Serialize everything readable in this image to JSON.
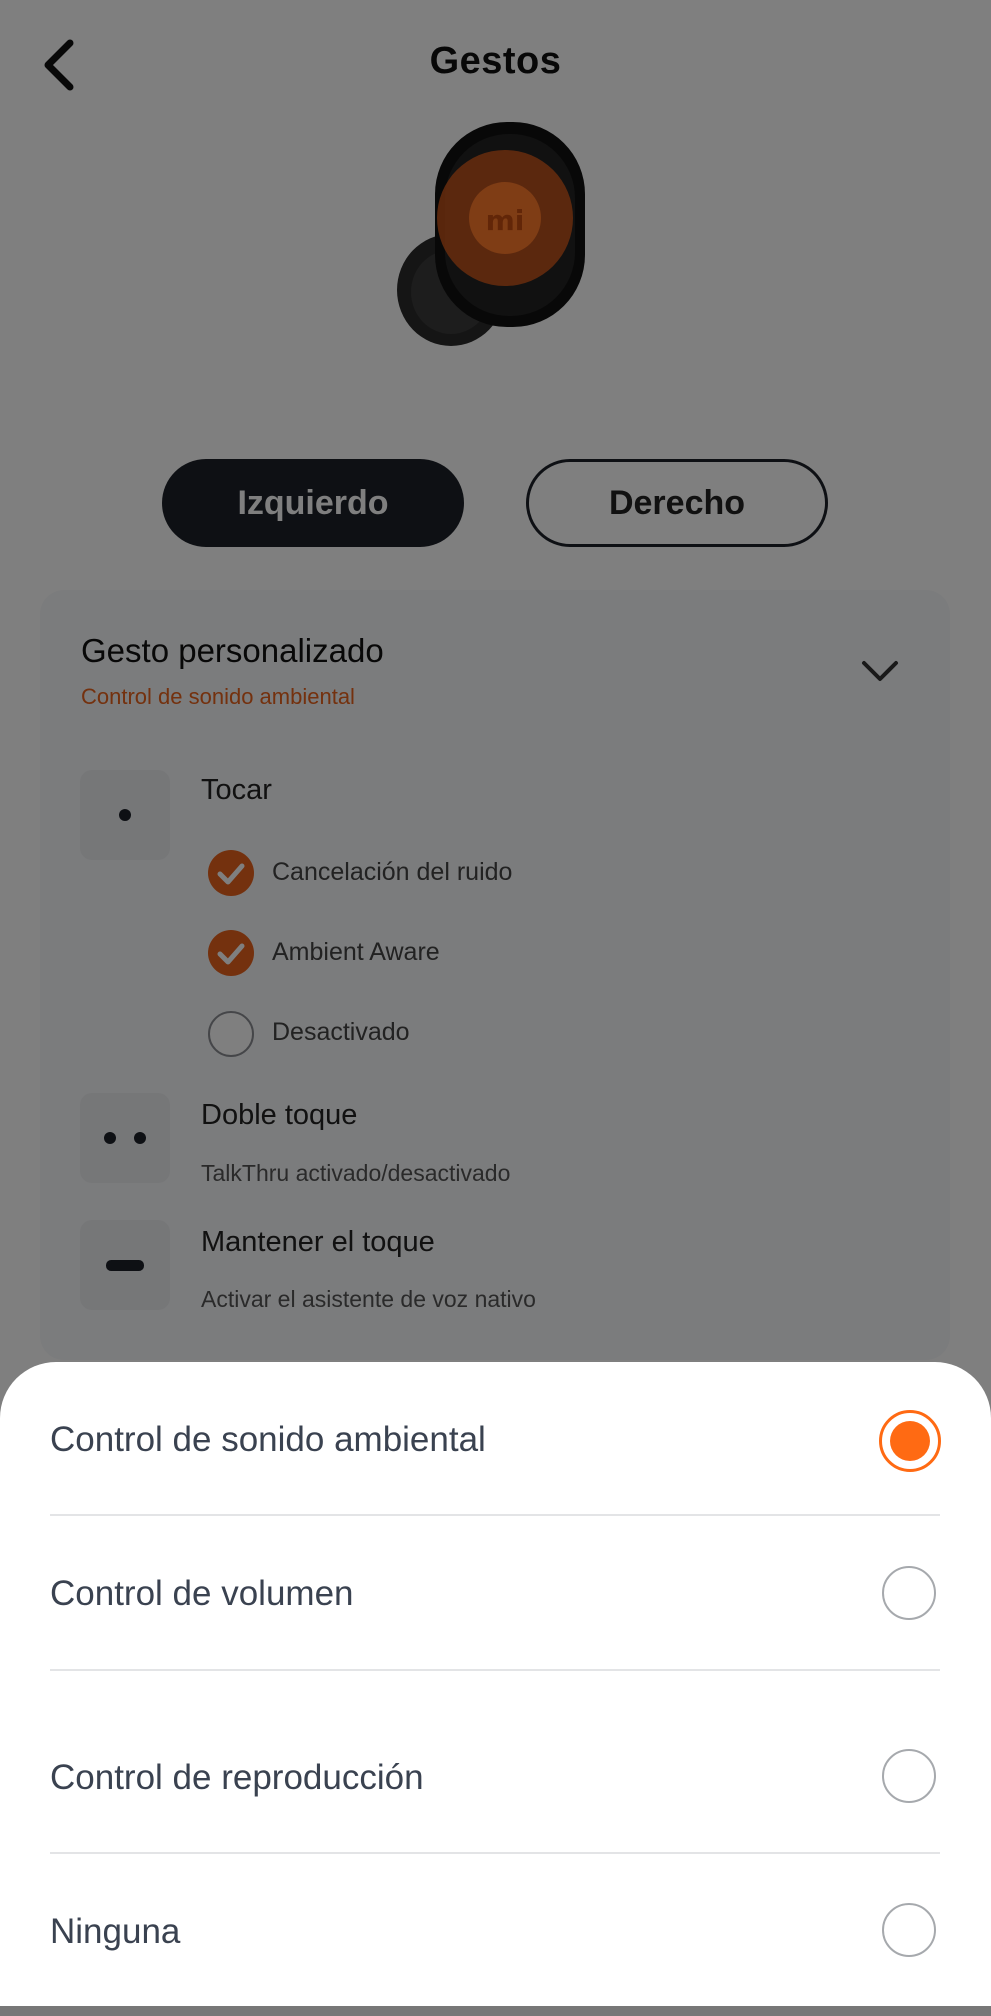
{
  "header": {
    "title": "Gestos",
    "back_icon": "chevron-left-icon"
  },
  "earbud": {
    "icon": "earbud-image",
    "highlight_color": "#e8621c"
  },
  "tabs": [
    {
      "label": "Izquierdo",
      "selected": true
    },
    {
      "label": "Derecho",
      "selected": false
    }
  ],
  "card": {
    "title": "Gesto personalizado",
    "subtitle": "Control de sonido ambiental",
    "expand_icon": "chevron-down-icon",
    "gestures": [
      {
        "label": "Tocar",
        "icon": "single-tap-icon",
        "options": [
          {
            "label": "Cancelación del ruido",
            "checked": true
          },
          {
            "label": "Ambient Aware",
            "checked": true
          },
          {
            "label": "Desactivado",
            "checked": false
          }
        ]
      },
      {
        "label": "Doble toque",
        "icon": "double-tap-icon",
        "description": "TalkThru activado/desactivado"
      },
      {
        "label": "Mantener el toque",
        "icon": "hold-icon",
        "description": "Activar el asistente de voz nativo"
      }
    ]
  },
  "sheet": {
    "options": [
      {
        "label": "Control de sonido ambiental",
        "selected": true
      },
      {
        "label": "Control de volumen",
        "selected": false
      },
      {
        "label": "Control de reproducción",
        "selected": false
      },
      {
        "label": "Ninguna",
        "selected": false
      }
    ]
  },
  "colors": {
    "accent": "#e8621c",
    "radio_selected": "#ff6a13",
    "dark": "#1c2129"
  }
}
